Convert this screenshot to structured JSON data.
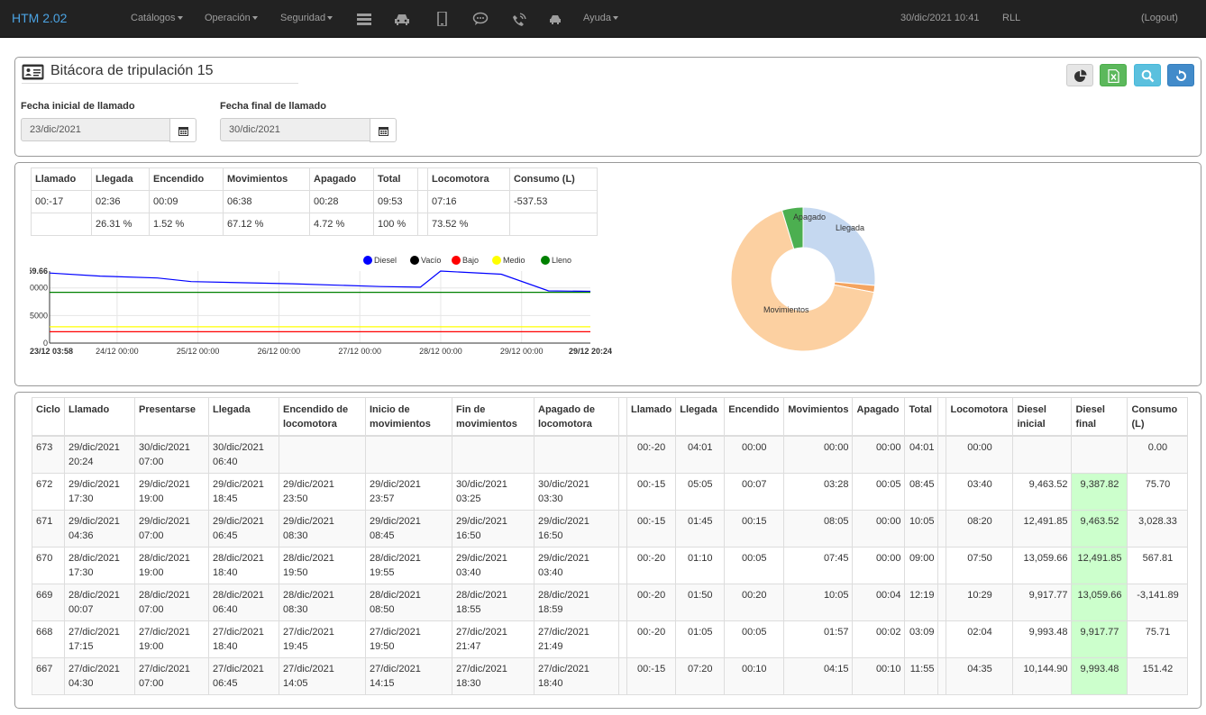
{
  "navbar": {
    "brand": "HTM 2.02",
    "menus": [
      {
        "label": "Catálogos"
      },
      {
        "label": "Operación"
      },
      {
        "label": "Seguridad"
      }
    ],
    "icons": [
      "server-icon",
      "car-icon",
      "mobile-icon",
      "chat-icon",
      "phone-signal-icon",
      "car-small-icon"
    ],
    "help": "Ayuda",
    "datetime": "30/dic/2021 10:41",
    "user": "RLL",
    "logout": "(Logout)"
  },
  "header": {
    "title": "Bitácora de tripulación 15",
    "start_label": "Fecha inicial de llamado",
    "start_value": "23/dic/2021",
    "end_label": "Fecha final de llamado",
    "end_value": "30/dic/2021",
    "toolbar_colors": {
      "pie": "#e6e6e6",
      "excel": "#5cb85c",
      "search": "#5bc0de",
      "refresh": "#428bca"
    }
  },
  "summary": {
    "headers": [
      "Llamado",
      "Llegada",
      "Encendido",
      "Movimientos",
      "Apagado",
      "Total",
      "",
      "Locomotora",
      "Consumo (L)"
    ],
    "times": [
      "00:-17",
      "02:36",
      "00:09",
      "06:38",
      "00:28",
      "09:53",
      "",
      "07:16",
      "-537.53"
    ],
    "percents": [
      "",
      "26.31 %",
      "1.52 %",
      "67.12 %",
      "4.72 %",
      "100 %",
      "",
      "73.52 %",
      ""
    ]
  },
  "chart_data": [
    {
      "type": "line",
      "legend": [
        "Diesel",
        "Vacío",
        "Bajo",
        "Medio",
        "Lleno"
      ],
      "legend_colors": [
        "#0000ff",
        "#000000",
        "#ff0000",
        "#ffff00",
        "#008000"
      ],
      "y_ticks": [
        "0",
        "5000",
        "0000",
        "59.66"
      ],
      "x_ticks": [
        "23/12 03:58",
        "24/12 00:00",
        "25/12 00:00",
        "26/12 00:00",
        "27/12 00:00",
        "28/12 00:00",
        "29/12 00:00",
        "29/12 20:24"
      ],
      "x_hours": [
        0,
        20.03,
        44.03,
        68.03,
        92.03,
        116.03,
        140.03,
        160.43
      ],
      "ylim": [
        0,
        13059.66
      ],
      "series": [
        {
          "name": "Diesel",
          "color": "#0000ff",
          "points": [
            [
              0,
              12700
            ],
            [
              15,
              12150
            ],
            [
              32,
              11800
            ],
            [
              42,
              11150
            ],
            [
              72,
              10750
            ],
            [
              98,
              10250
            ],
            [
              110,
              10144.9
            ],
            [
              116,
              13059.66
            ],
            [
              134,
              12491.85
            ],
            [
              148,
              9463.52
            ],
            [
              160.43,
              9387.82
            ]
          ]
        },
        {
          "name": "Lleno",
          "color": "#008000",
          "points": [
            [
              0,
              9200
            ],
            [
              160.43,
              9200
            ]
          ]
        },
        {
          "name": "Medio",
          "color": "#ffff00",
          "points": [
            [
              0,
              2950
            ],
            [
              160.43,
              2950
            ]
          ]
        },
        {
          "name": "Bajo",
          "color": "#ff0000",
          "points": [
            [
              0,
              2050
            ],
            [
              160.43,
              2050
            ]
          ]
        }
      ]
    },
    {
      "type": "pie",
      "slices": [
        {
          "label": "Llegada",
          "value": 26.31,
          "color": "#c5d8f0"
        },
        {
          "label": "",
          "value": 1.52,
          "color": "#f4a460"
        },
        {
          "label": "Movimientos",
          "value": 67.12,
          "color": "#fcd0a1"
        },
        {
          "label": "Apagado",
          "value": 4.72,
          "color": "#4caf50"
        }
      ]
    }
  ],
  "table": {
    "headers": [
      "Ciclo",
      "Llamado",
      "Presentarse",
      "Llegada",
      "Encendido de locomotora",
      "Inicio de movimientos",
      "Fin de movimientos",
      "Apagado de locomotora",
      "",
      "Llamado",
      "Llegada",
      "Encendido",
      "Movimientos",
      "Apagado",
      "Total",
      "",
      "Locomotora",
      "Diesel inicial",
      "Diesel final",
      "Consumo (L)"
    ],
    "rows": [
      {
        "ciclo": "673",
        "llamado": [
          "29/dic/2021",
          "20:24"
        ],
        "presentarse": [
          "30/dic/2021",
          "07:00"
        ],
        "llegada": [
          "30/dic/2021",
          "06:40"
        ],
        "encendido": [
          "",
          ""
        ],
        "inicio": [
          "",
          ""
        ],
        "fin": [
          "",
          ""
        ],
        "apagado": [
          "",
          ""
        ],
        "t_llamado": "00:-20",
        "t_llegada": "04:01",
        "t_encendido": "00:00",
        "t_mov": "00:00",
        "t_apagado": "00:00",
        "t_total": "04:01",
        "locomotora": "00:00",
        "d_ini": "",
        "d_fin": "",
        "consumo": "0.00"
      },
      {
        "ciclo": "672",
        "llamado": [
          "29/dic/2021",
          "17:30"
        ],
        "presentarse": [
          "29/dic/2021",
          "19:00"
        ],
        "llegada": [
          "29/dic/2021",
          "18:45"
        ],
        "encendido": [
          "29/dic/2021",
          "23:50"
        ],
        "inicio": [
          "29/dic/2021",
          "23:57"
        ],
        "fin": [
          "30/dic/2021",
          "03:25"
        ],
        "apagado": [
          "30/dic/2021",
          "03:30"
        ],
        "t_llamado": "00:-15",
        "t_llegada": "05:05",
        "t_encendido": "00:07",
        "t_mov": "03:28",
        "t_apagado": "00:05",
        "t_total": "08:45",
        "locomotora": "03:40",
        "d_ini": "9,463.52",
        "d_fin": "9,387.82",
        "consumo": "75.70"
      },
      {
        "ciclo": "671",
        "llamado": [
          "29/dic/2021",
          "04:36"
        ],
        "presentarse": [
          "29/dic/2021",
          "07:00"
        ],
        "llegada": [
          "29/dic/2021",
          "06:45"
        ],
        "encendido": [
          "29/dic/2021",
          "08:30"
        ],
        "inicio": [
          "29/dic/2021",
          "08:45"
        ],
        "fin": [
          "29/dic/2021",
          "16:50"
        ],
        "apagado": [
          "29/dic/2021",
          "16:50"
        ],
        "t_llamado": "00:-15",
        "t_llegada": "01:45",
        "t_encendido": "00:15",
        "t_mov": "08:05",
        "t_apagado": "00:00",
        "t_total": "10:05",
        "locomotora": "08:20",
        "d_ini": "12,491.85",
        "d_fin": "9,463.52",
        "consumo": "3,028.33"
      },
      {
        "ciclo": "670",
        "llamado": [
          "28/dic/2021",
          "17:30"
        ],
        "presentarse": [
          "28/dic/2021",
          "19:00"
        ],
        "llegada": [
          "28/dic/2021",
          "18:40"
        ],
        "encendido": [
          "28/dic/2021",
          "19:50"
        ],
        "inicio": [
          "28/dic/2021",
          "19:55"
        ],
        "fin": [
          "29/dic/2021",
          "03:40"
        ],
        "apagado": [
          "29/dic/2021",
          "03:40"
        ],
        "t_llamado": "00:-20",
        "t_llegada": "01:10",
        "t_encendido": "00:05",
        "t_mov": "07:45",
        "t_apagado": "00:00",
        "t_total": "09:00",
        "locomotora": "07:50",
        "d_ini": "13,059.66",
        "d_fin": "12,491.85",
        "consumo": "567.81"
      },
      {
        "ciclo": "669",
        "llamado": [
          "28/dic/2021",
          "00:07"
        ],
        "presentarse": [
          "28/dic/2021",
          "07:00"
        ],
        "llegada": [
          "28/dic/2021",
          "06:40"
        ],
        "encendido": [
          "28/dic/2021",
          "08:30"
        ],
        "inicio": [
          "28/dic/2021",
          "08:50"
        ],
        "fin": [
          "28/dic/2021",
          "18:55"
        ],
        "apagado": [
          "28/dic/2021",
          "18:59"
        ],
        "t_llamado": "00:-20",
        "t_llegada": "01:50",
        "t_encendido": "00:20",
        "t_mov": "10:05",
        "t_apagado": "00:04",
        "t_total": "12:19",
        "locomotora": "10:29",
        "d_ini": "9,917.77",
        "d_fin": "13,059.66",
        "consumo": "-3,141.89"
      },
      {
        "ciclo": "668",
        "llamado": [
          "27/dic/2021",
          "17:15"
        ],
        "presentarse": [
          "27/dic/2021",
          "19:00"
        ],
        "llegada": [
          "27/dic/2021",
          "18:40"
        ],
        "encendido": [
          "27/dic/2021",
          "19:45"
        ],
        "inicio": [
          "27/dic/2021",
          "19:50"
        ],
        "fin": [
          "27/dic/2021",
          "21:47"
        ],
        "apagado": [
          "27/dic/2021",
          "21:49"
        ],
        "t_llamado": "00:-20",
        "t_llegada": "01:05",
        "t_encendido": "00:05",
        "t_mov": "01:57",
        "t_apagado": "00:02",
        "t_total": "03:09",
        "locomotora": "02:04",
        "d_ini": "9,993.48",
        "d_fin": "9,917.77",
        "consumo": "75.71"
      },
      {
        "ciclo": "667",
        "llamado": [
          "27/dic/2021",
          "04:30"
        ],
        "presentarse": [
          "27/dic/2021",
          "07:00"
        ],
        "llegada": [
          "27/dic/2021",
          "06:45"
        ],
        "encendido": [
          "27/dic/2021",
          "14:05"
        ],
        "inicio": [
          "27/dic/2021",
          "14:15"
        ],
        "fin": [
          "27/dic/2021",
          "18:30"
        ],
        "apagado": [
          "27/dic/2021",
          "18:40"
        ],
        "t_llamado": "00:-15",
        "t_llegada": "07:20",
        "t_encendido": "00:10",
        "t_mov": "04:15",
        "t_apagado": "00:10",
        "t_total": "11:55",
        "locomotora": "04:35",
        "d_ini": "10,144.90",
        "d_fin": "9,993.48",
        "consumo": "151.42"
      }
    ]
  }
}
